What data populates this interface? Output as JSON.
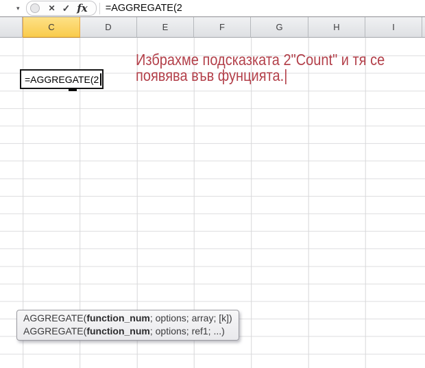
{
  "formula_bar": {
    "icons": {
      "chevron_down": "▾",
      "cancel": "✕",
      "enter": "✓",
      "insert_function": "fx"
    },
    "formula": "=AGGREGATE(2"
  },
  "columns": [
    "C",
    "D",
    "E",
    "F",
    "G",
    "H",
    "I"
  ],
  "selected_column": "C",
  "cell_editor": {
    "text": "=AGGREGATE(2"
  },
  "annotation": {
    "line1": "Избрахме подсказката 2\"Count\" и тя се",
    "line2": "появява във фунцията.|",
    "color": "#b3404a"
  },
  "tooltip": {
    "lines": [
      {
        "pre": "AGGREGATE(",
        "bold": "function_num",
        "post": "; options; array; [k])"
      },
      {
        "pre": "AGGREGATE(",
        "bold": "function_num",
        "post": "; options; ref1; ...)"
      }
    ]
  },
  "colors": {
    "selected_header_bg": "#f9cb4b",
    "annotation_red": "#b3404a"
  }
}
